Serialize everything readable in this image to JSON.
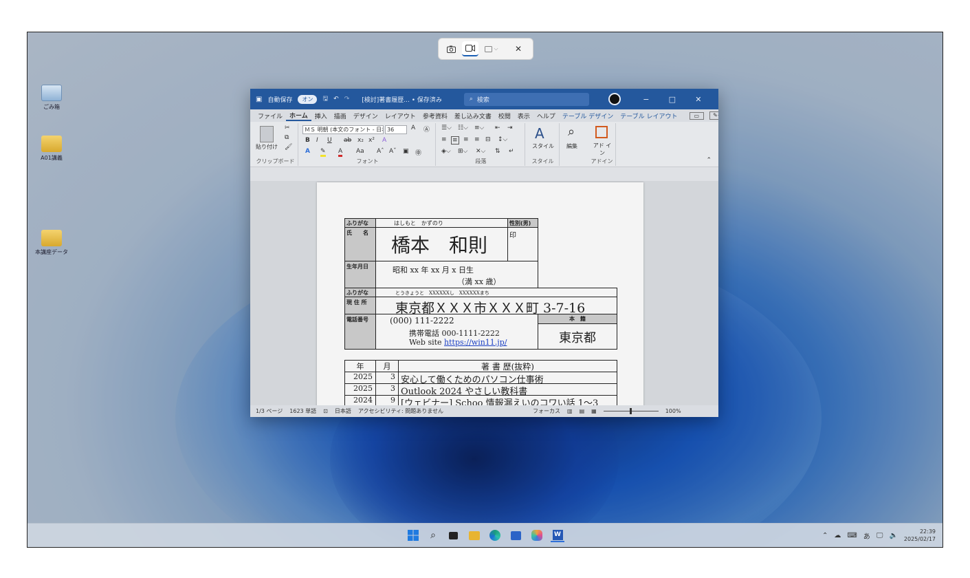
{
  "desktop": {
    "icons": [
      {
        "label": "ごみ箱",
        "icon": "recycle-bin-icon"
      },
      {
        "label": "A01講義",
        "icon": "folder-icon"
      },
      {
        "label": "本講座データ",
        "icon": "folder-icon"
      }
    ]
  },
  "snip_toolbar": {
    "screenshot_icon": "camera-icon",
    "record_icon": "video-icon",
    "shape_icon": "rectangle-icon",
    "shape_caret": "⌵",
    "close_glyph": "✕"
  },
  "word": {
    "titlebar": {
      "autosave_label": "自動保存",
      "autosave_state": "オン",
      "doc_title": "[検討]著書履歴... • 保存済み",
      "search_placeholder": "検索",
      "min_glyph": "−",
      "max_glyph": "□",
      "close_glyph": "✕"
    },
    "menu": [
      "ファイル",
      "ホーム",
      "挿入",
      "描画",
      "デザイン",
      "レイアウト",
      "参考資料",
      "差し込み文書",
      "校閲",
      "表示",
      "ヘルプ",
      "テーブル デザイン",
      "テーブル レイアウト"
    ],
    "ribbon": {
      "clipboard": {
        "paste_label": "貼り付け",
        "group_label": "クリップボード"
      },
      "font": {
        "font_name": "ＭＳ 明朝 (本文のフォント - 日本",
        "font_size": "36",
        "group_label": "フォント"
      },
      "paragraph": {
        "group_label": "段落"
      },
      "styles": {
        "styles_label": "スタイル",
        "group_label": "スタイル"
      },
      "editing": {
        "editing_label": "編集"
      },
      "addins": {
        "addins_label": "アド イン",
        "group_label": "アドイン"
      }
    },
    "document": {
      "furigana_label": "ふりがな",
      "furigana_name": "はしもと　かずのり",
      "name_label": "氏　　名",
      "name": "橋本　和則",
      "gender_label": "性別(男)",
      "seal": "印",
      "birth_label": "生年月日",
      "birth": "昭和 xx 年 xx 月 x 日生",
      "age": "（満 xx 歳）",
      "furigana_address_label": "ふりがな",
      "furigana_address": "とうきょうと　XXXXXXし　XXXXXXまち",
      "address_label": "現 住 所",
      "address": "東京都ＸＸＸ市ＸＸＸ町 3-7-16",
      "phone_label": "電話番号",
      "phone": "(000) 111-2222",
      "mobile": "携帯電話 000-1111-2222",
      "web_prefix": "Web site ",
      "web_link": "https://win11.jp/",
      "honseki_label": "本　籍",
      "honseki": "東京都",
      "history_headers": {
        "year": "年",
        "month": "月",
        "title": "著 書 歴(抜粋)"
      },
      "history_rows": [
        {
          "year": "2025",
          "month": "3",
          "title": "安心して働くためのパソコン仕事術"
        },
        {
          "year": "2025",
          "month": "3",
          "title": "Outlook 2024 やさしい教科書"
        },
        {
          "year": "2024",
          "month": "9",
          "title": "[ウェビナー] Schoo 情報漏えいのコワい話 1～3"
        }
      ]
    },
    "statusbar": {
      "page": "1/3 ページ",
      "words": "1623 単語",
      "language": "日本語",
      "accessibility": "アクセシビリティ: 問題ありません",
      "focus": "フォーカス",
      "zoom": "100%"
    }
  },
  "taskbar": {
    "items": [
      "start-icon",
      "search-icon",
      "task-view-icon",
      "file-explorer-icon",
      "edge-icon",
      "store-icon",
      "copilot-icon",
      "word-icon"
    ],
    "tray": {
      "ime": "あ",
      "time": "22:39",
      "date": "2025/02/17"
    }
  },
  "colors": {
    "word_blue": "#24589d",
    "desktop_blue": "#0e57c2",
    "link": "#1a3fc4"
  }
}
